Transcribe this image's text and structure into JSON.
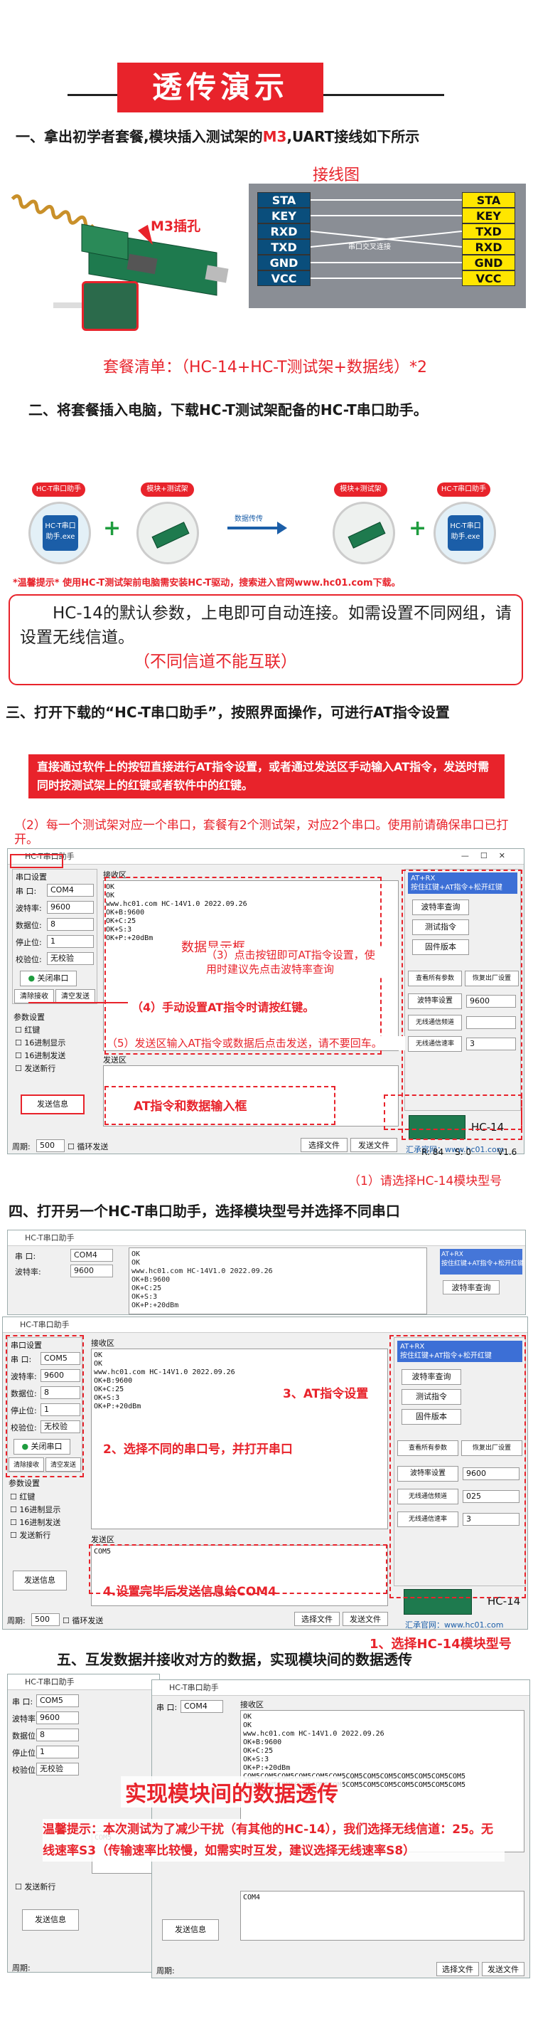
{
  "title": "透传演示",
  "s1": {
    "a": "一、拿出初学者套餐,模块插入测试架的",
    "b": "M3",
    "c": ",UART接线如下所示",
    "diagram_title": "接线图",
    "m3_label": "M3插孔",
    "cross_label": "串口交叉连接",
    "left_pins": [
      "STA",
      "KEY",
      "RXD",
      "TXD",
      "GND",
      "VCC"
    ],
    "right_pins": [
      "STA",
      "KEY",
      "TXD",
      "RXD",
      "GND",
      "VCC"
    ],
    "kit": "套餐清单：（HC-14+HC-T测试架+数据线）*2"
  },
  "s2": {
    "heading": "二、将套餐插入电脑，下载HC-T测试架配备的HC-T串口助手。",
    "tag1": "HC-T串口助手",
    "tag2": "模块+测试架",
    "tag3": "模块+测试架",
    "tag4": "HC-T串口助手",
    "exe1": "HC-T串口助手.exe",
    "exe2": "HC-T串口助手.exe",
    "plus": "+",
    "arrow_label": "数据传传",
    "note": "*温馨提示* 使用HC-T测试架前电脑需安装HC-T驱动，搜索进入官网www.hc01.com下载。",
    "box1": "HC-14的默认参数，上电即可自动连接。如需设置不同网组，请设置无线信道。",
    "box2": "（不同信道不能互联）"
  },
  "s3": {
    "heading": "三、打开下载的“HC-T串口助手”，按照界面操作，可进行AT指令设置",
    "redbox": "直接通过软件上的按钮直接进行AT指令设置，或者通过发送区手动输入AT指令，发送时需同时按测试架上的红键或者软件中的红键。",
    "n2": "（2）每一个测试架对应一个串口，套餐有2个测试架，对应2个串口。使用前请确保串口已打开。",
    "win_title": "HC-T串口助手",
    "port": {
      "g": "串口设置",
      "port_l": "串 口:",
      "port_v": "COM4",
      "baud_l": "波特率:",
      "baud_v": "9600",
      "data_l": "数据位:",
      "data_v": "8",
      "stop_l": "停止位:",
      "stop_v": "1",
      "par_l": "校验位:",
      "par_v": "无校验",
      "close": "关闭串口",
      "clear": "清除接收",
      "clearsend": "清空发送"
    },
    "recv_g": "接收区",
    "recv": "OK\nOK\nwww.hc01.com HC-14V1.0 2022.09.26\nOK+B:9600\nOK+C:25\nOK+S:3\nOK+P:+20dBm",
    "disp": "数据显示框",
    "at": "AT+RX\n按住红键+AT指令+松开红键",
    "btns": [
      "波特率查询",
      "测试指令",
      "固件版本",
      "查看所有参数",
      "恢复出厂设置"
    ],
    "baud_set": "波特率设置",
    "baud_set_v": "9600",
    "ch_set": "无线通信频道",
    "rate_set": "无线通信速率",
    "rate_v": "3",
    "n3": "（3）点击按钮即可AT指令设置，使用时建议先点击波特率查询",
    "n4": "（4）手动设置AT指令时请按红键。",
    "n5": "（5）发送区输入AT指令或数据后点击发送，请不要回车。",
    "send_g": "发送区",
    "at_input": "AT指令和数据输入框",
    "opts": [
      "红键",
      "16进制显示",
      "16进制发送",
      "发送新行"
    ],
    "opts_g": "参数设置",
    "send_btn": "发送信息",
    "cycle": "周期:",
    "cycle_v": "500",
    "loop": "循环发送",
    "sel_file": "选择文件",
    "send_file": "发送文件",
    "site": "汇承官网：www.hc01.com",
    "rx": "R: 84",
    "sx": "S: 0",
    "ver": "V1.6",
    "model": "HC-14",
    "n1": "（1）请选择HC-14模块型号"
  },
  "s4": {
    "heading": "四、打开另一个HC-T串口助手，选择模块型号并选择不同串口",
    "port2": "COM5",
    "recv2": "OK\nOK\nwww.hc01.com HC-14V1.0 2022.09.26\nOK+B:9600\nOK+C:25\nOK+S:3\nOK+P:+20dBm",
    "c2": "2、选择不同的串口号，并打开串口",
    "c3": "3、AT指令设置",
    "c4": "4.设置完毕后发送信息给COM4",
    "c1": "1、选择HC-14模块型号",
    "ch_v": "025",
    "send_text": "COM5"
  },
  "s5": {
    "heading": "五、互发数据并接收对方的数据，实现模块间的数据透传",
    "big": "实现模块间的数据透传",
    "tip": "温馨提示：本次测试为了减少干扰（有其他的HC-14），我们选择无线信道：25。无线速率S3（传输速率比较慢，如需实时互发，建议选择无线速率S8）",
    "recvA": "OK\nOK\nwww.hc01.com HC-14V1.0 2022.09.26\nOK+B:9600\nOK+C:25\nOK+S:3\nOK+P:+20dBm\nCOM5COM5COM5COM5COM5COM5COM5COM5COM5COM5COM5COM5COM5\nCOM5COM5COM5COM5COM5COM5COM5COM5COM5COM5COM5COM5COM5",
    "sendA": "COM5",
    "sendB": "COM4"
  },
  "colors": {
    "red": "#e8232b",
    "navy": "#0a4e7c",
    "yellow": "#ffe600"
  }
}
